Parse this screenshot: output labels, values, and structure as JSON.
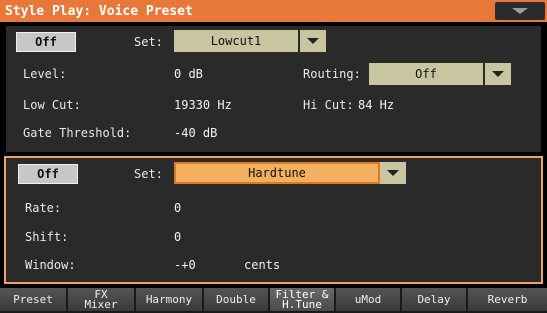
{
  "titlebar": {
    "title": "Style Play: Voice Preset"
  },
  "section1": {
    "toggle_label": "Off",
    "set_label": "Set:",
    "set_value": "Lowcut1",
    "level_label": "Level:",
    "level_value": "0 dB",
    "routing_label": "Routing:",
    "routing_value": "Off",
    "lowcut_label": "Low Cut:",
    "lowcut_value": "19330 Hz",
    "hicut_label": "Hi Cut:",
    "hicut_value": "84 Hz",
    "gate_label": "Gate Threshold:",
    "gate_value": "-40 dB"
  },
  "section2": {
    "toggle_label": "Off",
    "set_label": "Set:",
    "set_value": "Hardtune",
    "rate_label": "Rate:",
    "rate_value": "0",
    "shift_label": "Shift:",
    "shift_value": "0",
    "window_label": "Window:",
    "window_value": "-+0",
    "window_unit": "cents"
  },
  "tabs": [
    {
      "label": "Preset"
    },
    {
      "label": "FX\nMixer"
    },
    {
      "label": "Harmony"
    },
    {
      "label": "Double"
    },
    {
      "label": "Filter &\nH.Tune"
    },
    {
      "label": "uMod"
    },
    {
      "label": "Delay"
    },
    {
      "label": "Reverb"
    }
  ],
  "colors": {
    "accent": "#e8783a",
    "highlight": "#f3b060",
    "panel": "#2a2a2a"
  }
}
